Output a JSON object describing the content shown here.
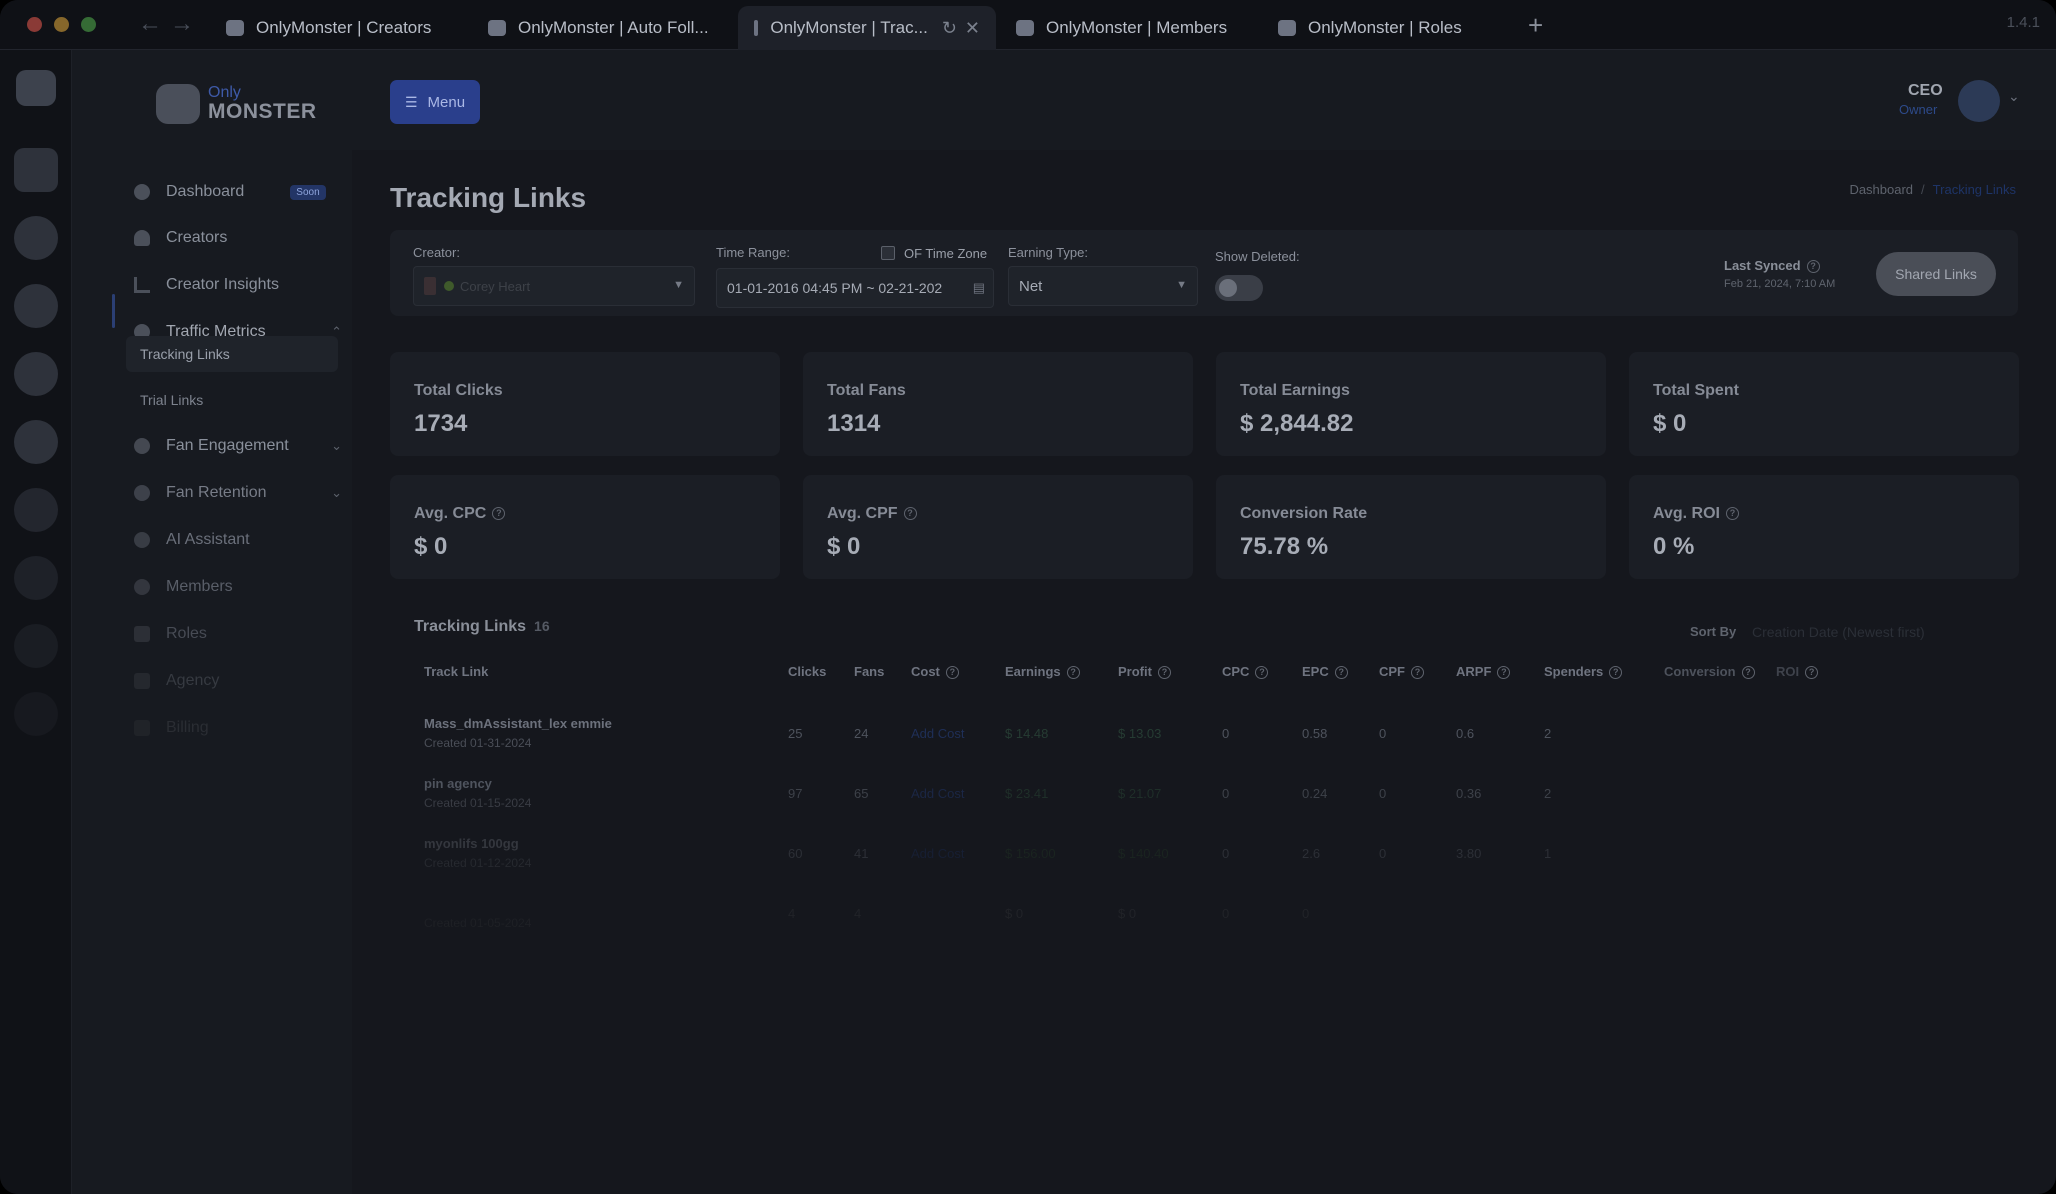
{
  "browser": {
    "tabs": [
      {
        "title": "OnlyMonster | Creators"
      },
      {
        "title": "OnlyMonster | Auto Foll..."
      },
      {
        "title": "OnlyMonster | Trac..."
      },
      {
        "title": "OnlyMonster | Members"
      },
      {
        "title": "OnlyMonster | Roles"
      }
    ],
    "version": "1.4.1"
  },
  "brand": {
    "only": "Only",
    "monster": "MONSTER"
  },
  "sidebar": {
    "items": [
      {
        "label": "Dashboard",
        "badge": "Soon",
        "icon": "dashboard-icon"
      },
      {
        "label": "Creators",
        "icon": "creators-icon"
      },
      {
        "label": "Creator Insights",
        "icon": "chart-bars-icon"
      },
      {
        "label": "Traffic Metrics",
        "icon": "traffic-icon"
      },
      {
        "label": "Fan Engagement",
        "icon": "fan-engagement-icon"
      },
      {
        "label": "Fan Retention",
        "icon": "fan-retention-icon"
      },
      {
        "label": "AI Assistant",
        "icon": "ai-assistant-icon"
      },
      {
        "label": "Members",
        "icon": "members-icon"
      },
      {
        "label": "Roles",
        "icon": "roles-icon"
      },
      {
        "label": "Agency",
        "icon": "agency-icon"
      },
      {
        "label": "Billing",
        "icon": "billing-icon"
      }
    ],
    "subitems": [
      {
        "label": "Tracking Links"
      },
      {
        "label": "Trial Links"
      }
    ]
  },
  "header": {
    "menu_label": "Menu",
    "user_role": "CEO",
    "user_subtitle": "Owner"
  },
  "page": {
    "title": "Tracking Links",
    "breadcrumb": [
      "Dashboard",
      "Tracking Links"
    ]
  },
  "filters": {
    "creator_label": "Creator:",
    "creator_value": "Corey Heart",
    "time_range_label": "Time Range:",
    "time_range_value": "01-01-2016 04:45 PM ~ 02-21-202",
    "of_timezone_label": "OF Time Zone",
    "earning_type_label": "Earning Type:",
    "earning_type_value": "Net",
    "show_deleted_label": "Show Deleted:",
    "last_synced_label": "Last Synced",
    "last_synced_value": "Feb 21, 2024, 7:10 AM",
    "shared_links_label": "Shared Links"
  },
  "stats": [
    {
      "label": "Total Clicks",
      "value": "1734"
    },
    {
      "label": "Total Fans",
      "value": "1314"
    },
    {
      "label": "Total Earnings",
      "value": "$ 2,844.82"
    },
    {
      "label": "Total Spent",
      "value": "$ 0"
    },
    {
      "label": "Avg. CPC",
      "value": "$ 0"
    },
    {
      "label": "Avg. CPF",
      "value": "$ 0"
    },
    {
      "label": "Conversion Rate",
      "value": "75.78 %"
    },
    {
      "label": "Avg. ROI",
      "value": "0 %"
    }
  ],
  "table": {
    "title": "Tracking Links",
    "count": "16",
    "sort_label": "Sort By",
    "sort_value": "Creation Date (Newest first)",
    "columns": [
      "Track Link",
      "Clicks",
      "Fans",
      "Cost",
      "Earnings",
      "Profit",
      "CPC",
      "EPC",
      "CPF",
      "ARPF",
      "Spenders",
      "Conversion",
      "ROI"
    ],
    "rows": [
      {
        "name": "Mass_dmAssistant_lex emmie",
        "created": "Created 01-31-2024",
        "clicks": "25",
        "fans": "24",
        "cost": "Add Cost",
        "earnings": "$ 14.48",
        "profit": "$ 13.03",
        "cpc": "0",
        "epc": "0.58",
        "cpf": "0",
        "arpf": "0.6",
        "spenders": "2"
      },
      {
        "name": "pin agency",
        "created": "Created 01-15-2024",
        "clicks": "97",
        "fans": "65",
        "cost": "Add Cost",
        "earnings": "$ 23.41",
        "profit": "$ 21.07",
        "cpc": "0",
        "epc": "0.24",
        "cpf": "0",
        "arpf": "0.36",
        "spenders": "2"
      },
      {
        "name": "myonlifs 100gg",
        "created": "Created 01-12-2024",
        "clicks": "60",
        "fans": "41",
        "cost": "Add Cost",
        "earnings": "$ 156.00",
        "profit": "$ 140.40",
        "cpc": "0",
        "epc": "2.6",
        "cpf": "0",
        "arpf": "3.80",
        "spenders": "1"
      },
      {
        "name": "",
        "created": "Created 01-05-2024",
        "clicks": "4",
        "fans": "4",
        "cost": "",
        "earnings": "$ 0",
        "profit": "$ 0",
        "cpc": "0",
        "epc": "0",
        "cpf": "",
        "arpf": "",
        "spenders": ""
      }
    ]
  },
  "colors": {
    "accent": "#2a3f8c",
    "background": "#15171d",
    "card": "#1b1e25"
  }
}
